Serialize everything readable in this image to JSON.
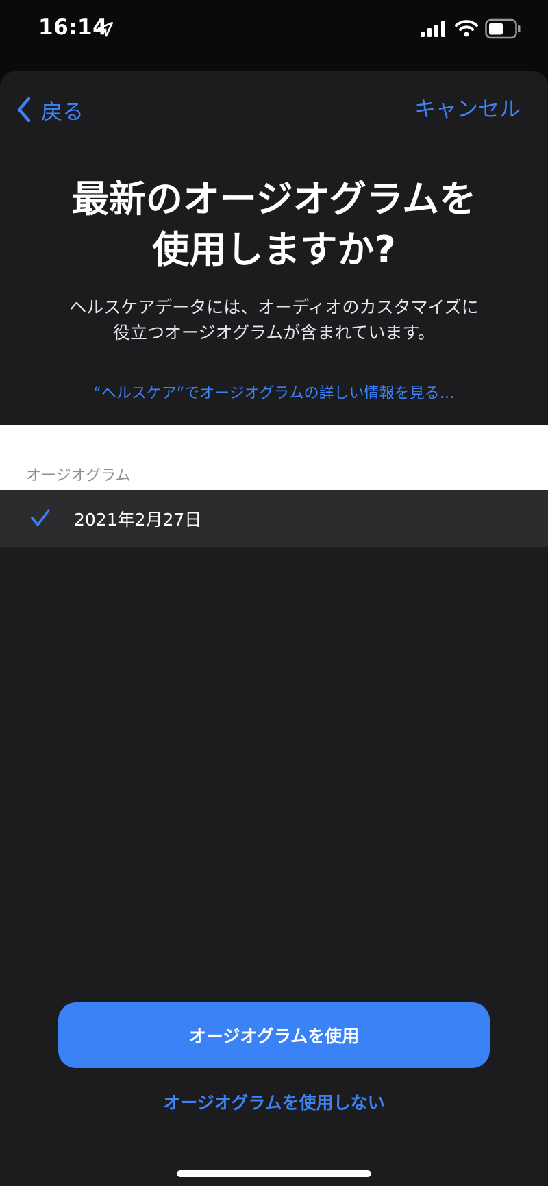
{
  "status_bar": {
    "time": "16:14",
    "location_icon": "location-arrow-icon",
    "signal_icon": "cellular-signal-icon",
    "wifi_icon": "wifi-icon",
    "battery_icon": "battery-icon"
  },
  "nav": {
    "back_label": "戻る",
    "cancel_label": "キャンセル"
  },
  "header": {
    "title_line1": "最新のオージオグラムを",
    "title_line2": "使用しますか?",
    "subtitle_line1": "ヘルスケアデータには、オーディオのカスタマイズに",
    "subtitle_line2": "役立つオージオグラムが含まれています。",
    "learn_more": "“ヘルスケア”でオージオグラムの詳しい情報を見る…"
  },
  "list": {
    "section_label": "オージオグラム",
    "items": [
      {
        "label": "2021年2月27日",
        "selected": true
      }
    ]
  },
  "actions": {
    "primary_label": "オージオグラムを使用",
    "secondary_label": "オージオグラムを使用しない"
  },
  "colors": {
    "accent": "#3b82f6",
    "sheet_background": "#1c1c1e",
    "row_background": "#2c2c2e",
    "status_background": "#0a0a0a"
  }
}
